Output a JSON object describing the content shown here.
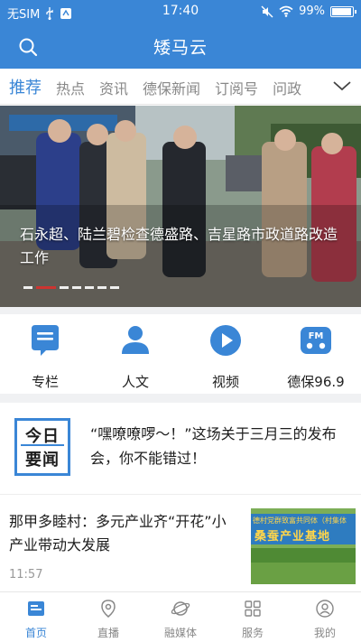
{
  "status_bar": {
    "carrier": "无SIM",
    "time": "17:40",
    "battery_percent": "99%",
    "battery_level": 0.99,
    "icons": [
      "usb-icon",
      "debug-icon",
      "mute-icon",
      "wifi-icon",
      "battery-icon"
    ]
  },
  "header": {
    "title": "矮马云",
    "search_icon": "search-icon"
  },
  "tabs": {
    "items": [
      "推荐",
      "热点",
      "资讯",
      "德保新闻",
      "订阅号",
      "问政"
    ],
    "active_index": 0,
    "more_icon": "chevron-down-icon"
  },
  "banner": {
    "caption": "石永超、陆兰碧检查德盛路、吉星路市政道路改造工作",
    "slide_count": 7,
    "active_slide": 1
  },
  "quick_links": [
    {
      "label": "专栏",
      "icon": "column-icon"
    },
    {
      "label": "人文",
      "icon": "person-icon"
    },
    {
      "label": "视频",
      "icon": "play-icon"
    },
    {
      "label": "德保96.9",
      "icon": "radio-fm-icon"
    }
  ],
  "headline": {
    "logo_line1": "今日",
    "logo_line2": "要闻",
    "text": "“嘿嘹嘹啰～！”这场关于三月三的发布会，你不能错过！"
  },
  "article": {
    "title": "那甲多睦村：多元产业齐“开花”小产业带动大发展",
    "time": "11:57",
    "thumb_sign_line1": "德村党群致富共同体（村集体",
    "thumb_sign_line2": "桑蚕产业基地"
  },
  "bottom_nav": {
    "items": [
      {
        "label": "首页",
        "icon": "home-icon"
      },
      {
        "label": "直播",
        "icon": "location-icon"
      },
      {
        "label": "融媒体",
        "icon": "planet-icon"
      },
      {
        "label": "服务",
        "icon": "grid-icon"
      },
      {
        "label": "我的",
        "icon": "user-icon"
      }
    ],
    "active_index": 0
  },
  "colors": {
    "brand": "#3a86d6",
    "accent_red": "#d9302c",
    "divider": "#f0f1f3"
  }
}
